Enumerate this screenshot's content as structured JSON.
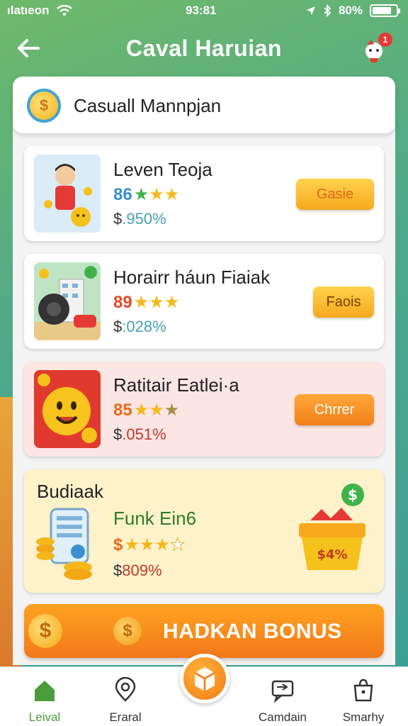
{
  "status": {
    "carrier": "ılatıeon",
    "time": "93:81",
    "battery": "80%"
  },
  "header": {
    "title": "Caval Haruian",
    "badge": "1"
  },
  "search": {
    "label": "Casuall Mannpjan"
  },
  "cards": [
    {
      "name": "Leven Teoja",
      "rating_num": "86",
      "stars": 3,
      "price_sym": "$",
      "price": ".950%",
      "button": "Gasie"
    },
    {
      "name": "Horairr háun Fiaiak",
      "rating_num": "89",
      "stars": 3,
      "price_sym": "$",
      "price": ":028%",
      "button": "Faois"
    },
    {
      "name": "Ratitair Eatlei·a",
      "rating_num": "85",
      "stars": 3,
      "price_sym": "$",
      "price": ".051%",
      "button": "Chrrer"
    },
    {
      "section": "Budiaak",
      "name": "Funk Ein6",
      "rating_num": "$",
      "stars": 3,
      "price_sym": "$",
      "price": "809%"
    }
  ],
  "bonus": {
    "label": "HADKAN BONUS"
  },
  "tabs": [
    {
      "label": "Leival",
      "icon": "home-icon"
    },
    {
      "label": "Eraral",
      "icon": "location-icon"
    },
    {
      "label": "Camdain",
      "icon": "message-icon"
    },
    {
      "label": "Smarhy",
      "icon": "bag-icon"
    }
  ],
  "colors": {
    "accent": "#f7a91c",
    "brand": "#4fa98a",
    "active": "#4a9d3a"
  }
}
